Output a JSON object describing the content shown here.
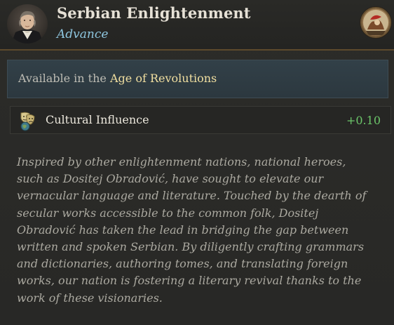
{
  "header": {
    "title": "Serbian Enlightenment",
    "subtitle": "Advance",
    "portrait_icon": "portrait-icon",
    "era_icon": "era-medallion-icon"
  },
  "availability": {
    "prefix": "Available in the ",
    "age_name": "Age of Revolutions"
  },
  "modifier": {
    "icon": "cultural-influence-icon",
    "label": "Cultural Influence",
    "value": "+0.10"
  },
  "flavor_text": [
    "Inspired by other enlightenment nations, national heroes,",
    "such as Dositej Obradović, have sought to elevate our",
    "vernacular language and literature. Touched by the dearth of",
    "secular works accessible to the common folk, Dositej",
    "Obradović has taken the lead in bridging the gap between",
    "written and spoken Serbian. By diligently crafting grammars",
    "and dictionaries, authoring tomes, and translating foreign",
    "works, our nation is fostering a literary revival thanks to the",
    "work of these visionaries."
  ],
  "colors": {
    "title": "#e6e1d6",
    "subtitle": "#8ec6df",
    "age_name": "#f1dfa0",
    "modifier_value": "#6cc66a",
    "flavor": "#aba9a0"
  }
}
